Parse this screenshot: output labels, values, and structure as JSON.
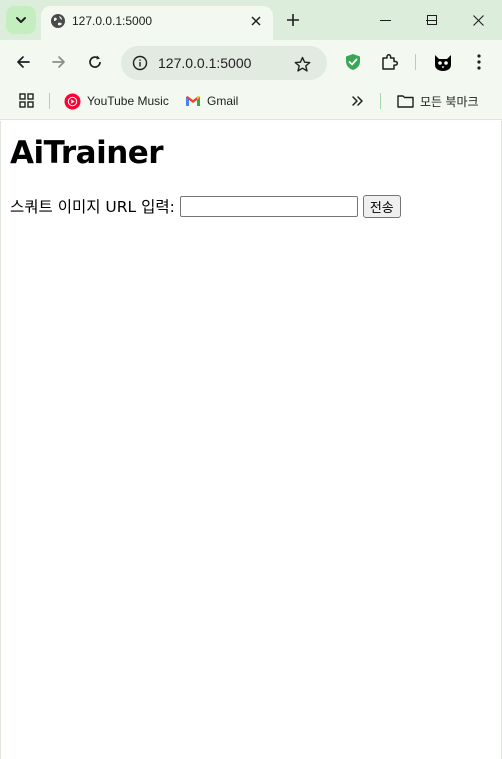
{
  "browser": {
    "tab": {
      "title": "127.0.0.1:5000"
    },
    "omnibox": {
      "url": "127.0.0.1:5000"
    },
    "bookmarks": [
      {
        "label": "YouTube Music",
        "icon": "youtube-music-icon"
      },
      {
        "label": "Gmail",
        "icon": "gmail-icon"
      }
    ],
    "all_bookmarks_label": "모든 북마크",
    "colors": {
      "tabstrip": "#dceedb",
      "toolbar": "#f3f9f1",
      "accent": "#c4eec0"
    }
  },
  "page": {
    "title": "AiTrainer",
    "form": {
      "label": "스쿼트 이미지 URL 입력:",
      "input_value": "",
      "submit_label": "전송"
    }
  }
}
